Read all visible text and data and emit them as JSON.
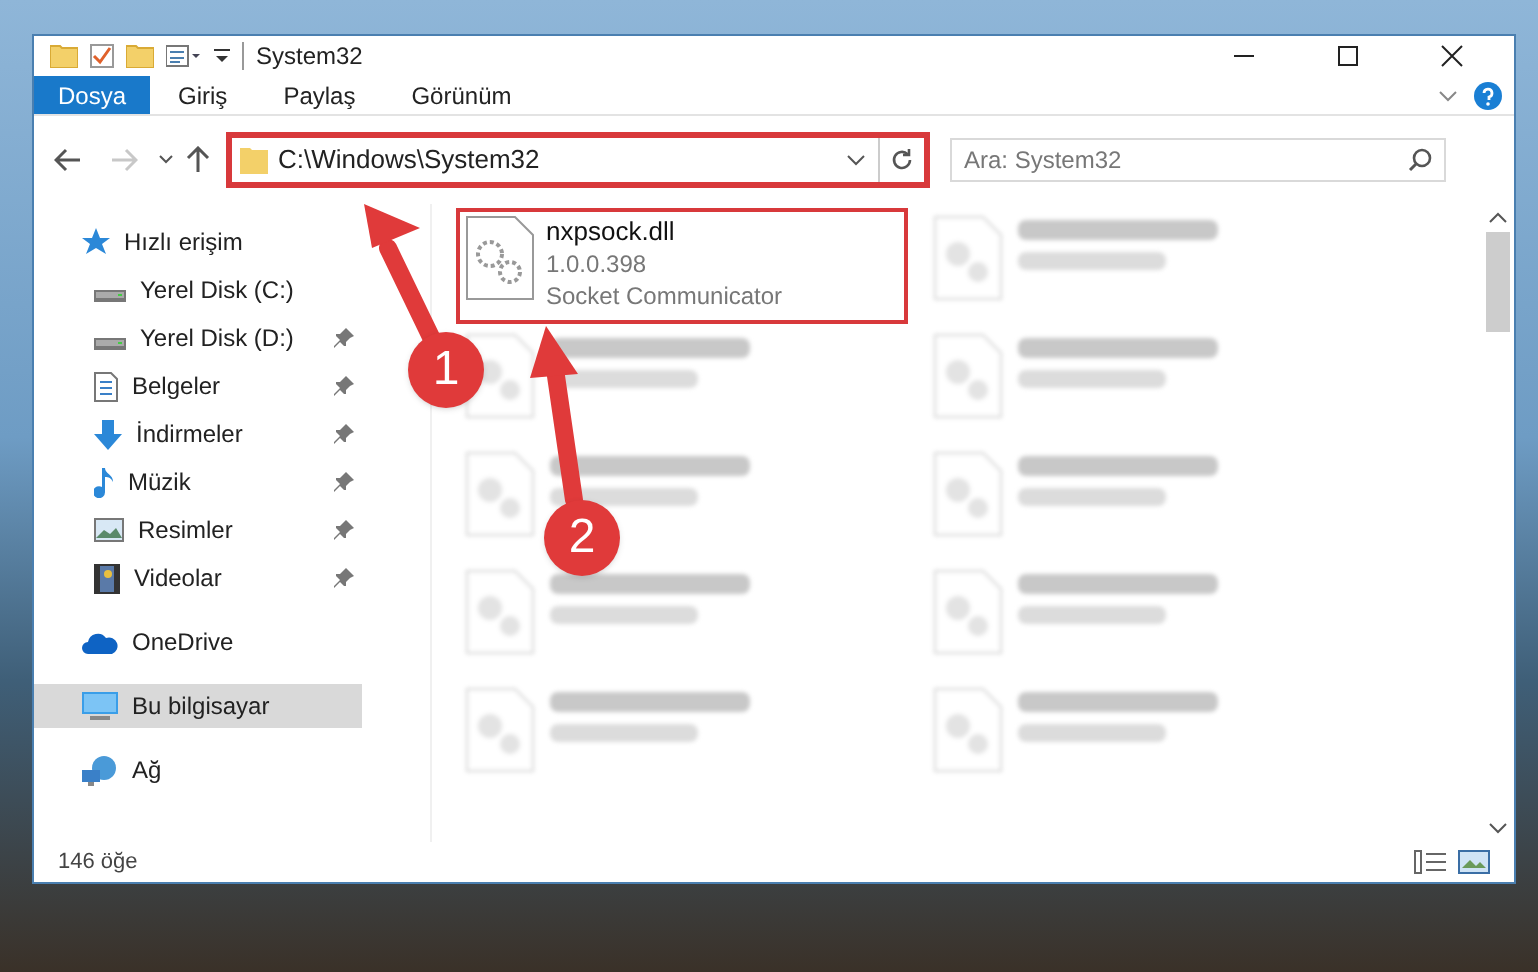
{
  "window": {
    "title": "System32"
  },
  "ribbon_tabs": [
    {
      "label": "Dosya",
      "selected": true
    },
    {
      "label": "Giriş",
      "selected": false
    },
    {
      "label": "Paylaş",
      "selected": false
    },
    {
      "label": "Görünüm",
      "selected": false
    }
  ],
  "address_bar": {
    "path": "C:\\Windows\\System32",
    "highlighted": true
  },
  "search": {
    "placeholder": "Ara: System32"
  },
  "sidebar": {
    "items": [
      {
        "label": "Hızlı erişim",
        "selected": false,
        "pinned": false,
        "children": [
          {
            "label": "Yerel Disk (C:)",
            "selected": false,
            "pinned": false
          },
          {
            "label": "Yerel Disk (D:)",
            "selected": false,
            "pinned": true
          },
          {
            "label": "Belgeler",
            "selected": false,
            "pinned": true
          },
          {
            "label": "İndirmeler",
            "selected": false,
            "pinned": true
          },
          {
            "label": "Müzik",
            "selected": false,
            "pinned": true
          },
          {
            "label": "Resimler",
            "selected": false,
            "pinned": true
          },
          {
            "label": "Videolar",
            "selected": false,
            "pinned": true
          }
        ]
      },
      {
        "label": "OneDrive",
        "selected": false,
        "pinned": false
      },
      {
        "label": "Bu bilgisayar",
        "selected": true,
        "pinned": false
      },
      {
        "label": "Ağ",
        "selected": false,
        "pinned": false
      }
    ]
  },
  "files": [
    {
      "name": "nxpsock.dll",
      "version": "1.0.0.398",
      "description": "Socket Communicator",
      "highlighted": true,
      "blurred": false
    },
    {
      "blurred": true
    },
    {
      "blurred": true
    },
    {
      "blurred": true
    },
    {
      "blurred": true
    },
    {
      "blurred": true
    },
    {
      "blurred": true
    },
    {
      "blurred": true
    },
    {
      "blurred": true
    },
    {
      "blurred": true
    }
  ],
  "status_bar": {
    "item_count": "146 öğe"
  },
  "annotations": [
    {
      "number": "1"
    },
    {
      "number": "2"
    }
  ]
}
